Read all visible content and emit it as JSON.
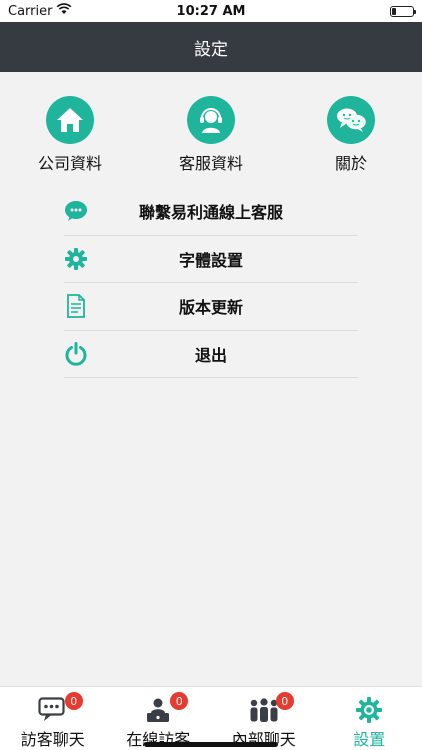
{
  "status_bar": {
    "carrier": "Carrier",
    "time": "10:27 AM",
    "battery_level": 0.2
  },
  "header": {
    "title": "設定"
  },
  "quick_items": [
    {
      "label": "公司資料",
      "icon": "home-icon"
    },
    {
      "label": "客服資料",
      "icon": "headset-agent-icon"
    },
    {
      "label": "關於",
      "icon": "chat-bubbles-icon"
    }
  ],
  "menu": [
    {
      "label": "聯繫易利通線上客服",
      "icon": "chat-bubble-icon"
    },
    {
      "label": "字體設置",
      "icon": "gear-icon"
    },
    {
      "label": "版本更新",
      "icon": "document-icon"
    },
    {
      "label": "退出",
      "icon": "power-icon"
    }
  ],
  "tabs": [
    {
      "label": "訪客聊天",
      "badge": "0",
      "icon": "chat-icon"
    },
    {
      "label": "在線訪客",
      "badge": "0",
      "icon": "visitor-icon"
    },
    {
      "label": "內部聊天",
      "badge": "0",
      "icon": "group-icon"
    },
    {
      "label": "設置",
      "icon": "settings-gear-icon",
      "active": true
    }
  ],
  "colors": {
    "accent": "#1fb59c",
    "header_bg": "#363b42",
    "badge": "#e63b2e"
  }
}
